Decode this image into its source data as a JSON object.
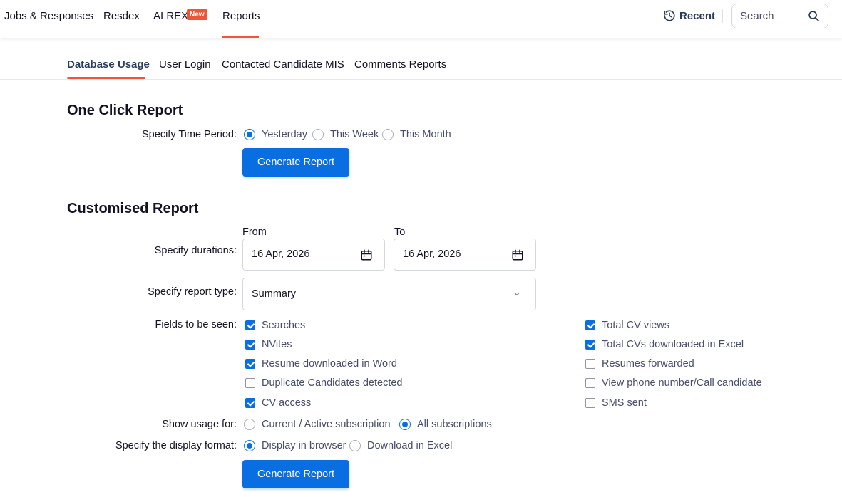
{
  "nav": {
    "items": [
      "Jobs & Responses",
      "Resdex",
      "AI REX",
      "Reports"
    ],
    "new_badge": "New",
    "recent": "Recent",
    "search_placeholder": "Search"
  },
  "subtabs": [
    "Database Usage",
    "User Login",
    "Contacted Candidate MIS",
    "Comments Reports"
  ],
  "one_click": {
    "title": "One Click Report",
    "period_label": "Specify Time Period:",
    "periods": [
      "Yesterday",
      "This Week",
      "This Month"
    ],
    "selected_period": "Yesterday",
    "button": "Generate Report"
  },
  "custom": {
    "title": "Customised Report",
    "durations_label": "Specify durations:",
    "from_label": "From",
    "to_label": "To",
    "from_value": "16 Apr, 2026",
    "to_value": "16 Apr, 2026",
    "report_type_label": "Specify report type:",
    "report_type_value": "Summary",
    "fields_label": "Fields to be seen:",
    "fields_left": [
      {
        "label": "Searches",
        "checked": true
      },
      {
        "label": "NVites",
        "checked": true
      },
      {
        "label": "Resume downloaded in Word",
        "checked": true
      },
      {
        "label": "Duplicate Candidates detected",
        "checked": false
      },
      {
        "label": "CV access",
        "checked": true
      }
    ],
    "fields_right": [
      {
        "label": "Total CV views",
        "checked": true
      },
      {
        "label": "Total CVs downloaded in Excel",
        "checked": true
      },
      {
        "label": "Resumes forwarded",
        "checked": false
      },
      {
        "label": "View phone number/Call candidate",
        "checked": false
      },
      {
        "label": "SMS sent",
        "checked": false
      }
    ],
    "usage_label": "Show usage for:",
    "usage_options": [
      "Current / Active subscription",
      "All subscriptions"
    ],
    "usage_selected": "All subscriptions",
    "format_label": "Specify the display format:",
    "format_options": [
      "Display in browser",
      "Download in Excel"
    ],
    "format_selected": "Display in browser",
    "button": "Generate Report"
  },
  "colors": {
    "accent": "#0a6ee3",
    "brand": "#f05537"
  }
}
